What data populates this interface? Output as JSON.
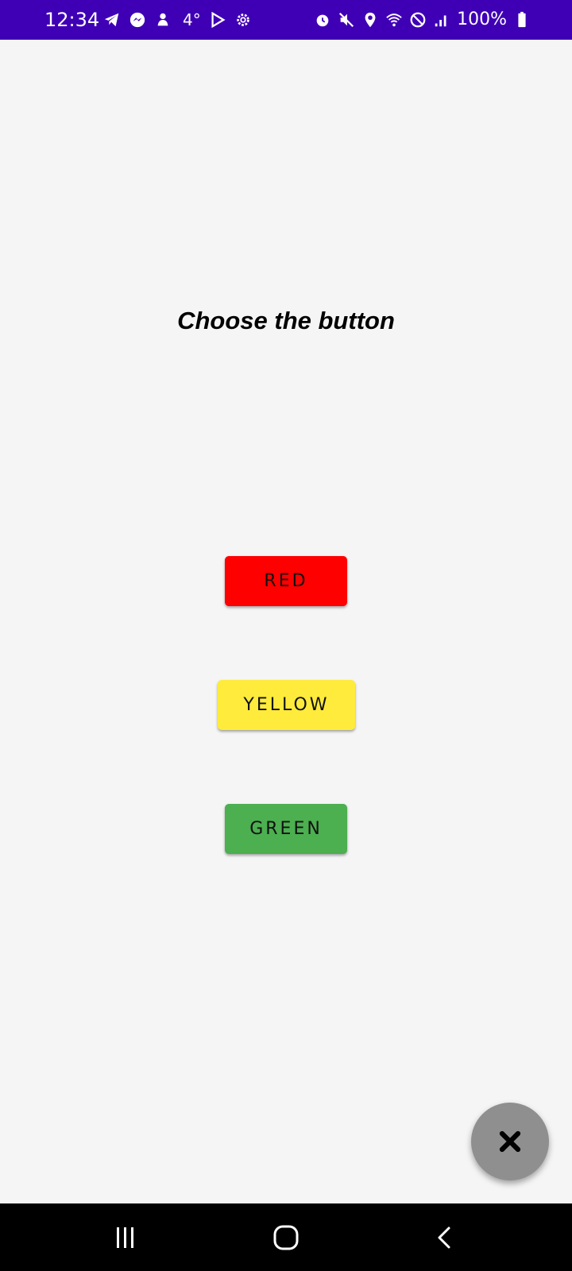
{
  "status_bar": {
    "time": "12:34",
    "temperature": "4°",
    "battery": "100%",
    "background": "#3f00b5",
    "left_icons": [
      "telegram-icon",
      "messenger-icon",
      "weather-icon"
    ],
    "right_icons": [
      "alarm-icon",
      "mute-icon",
      "location-icon",
      "wifi-icon",
      "do-not-disturb-icon",
      "signal-icon",
      "battery-icon"
    ]
  },
  "main": {
    "title": "Choose the button",
    "buttons": [
      {
        "label": "RED",
        "color": "#ff0000"
      },
      {
        "label": "YELLOW",
        "color": "#ffeb3b"
      },
      {
        "label": "GREEN",
        "color": "#4caf50"
      }
    ]
  },
  "fab": {
    "icon": "close-icon",
    "color": "#8f8f8f"
  },
  "nav_bar": {
    "items": [
      "recents-icon",
      "home-icon",
      "back-icon"
    ]
  }
}
